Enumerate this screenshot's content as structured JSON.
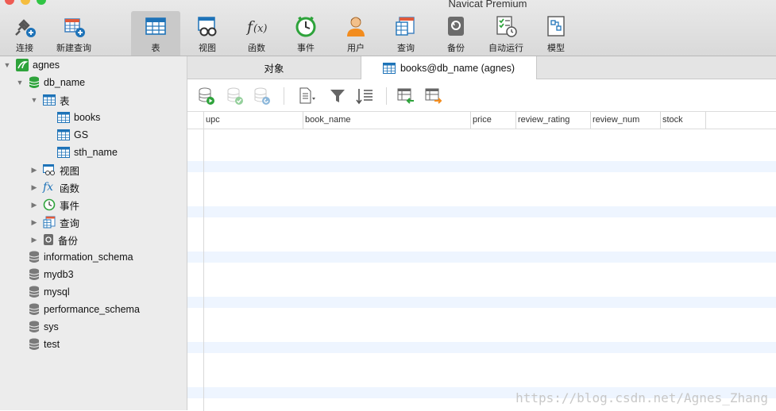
{
  "window": {
    "title": "Navicat Premium"
  },
  "toolbar": {
    "items": [
      {
        "label": "连接"
      },
      {
        "label": "新建查询"
      },
      {
        "label": "表"
      },
      {
        "label": "视图"
      },
      {
        "label": "函数"
      },
      {
        "label": "事件"
      },
      {
        "label": "用户"
      },
      {
        "label": "查询"
      },
      {
        "label": "备份"
      },
      {
        "label": "自动运行"
      },
      {
        "label": "模型"
      }
    ]
  },
  "sidebar": {
    "connection": "agnes",
    "database": "db_name",
    "tables_label": "表",
    "tables": [
      "books",
      "GS",
      "sth_name"
    ],
    "groups": [
      "视图",
      "函数",
      "事件",
      "查询",
      "备份"
    ],
    "other_databases": [
      "information_schema",
      "mydb3",
      "mysql",
      "performance_schema",
      "sys",
      "test"
    ]
  },
  "tabs": [
    {
      "label": "对象"
    },
    {
      "label": "books@db_name (agnes)"
    }
  ],
  "grid": {
    "columns": [
      "upc",
      "book_name",
      "price",
      "review_rating",
      "review_num",
      "stock"
    ]
  },
  "watermark": "https://blog.csdn.net/Agnes_Zhang",
  "colors": {
    "accent": "#1e73b8",
    "green": "#2ea33b",
    "stripe": "#eef5ff"
  }
}
